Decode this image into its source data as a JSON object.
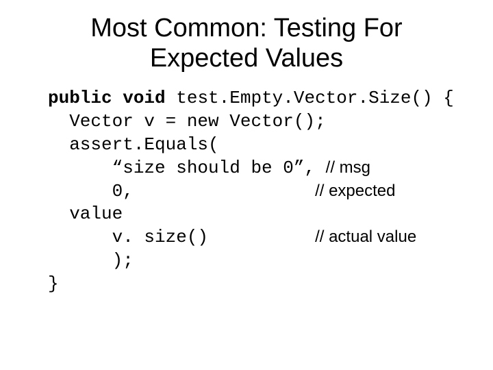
{
  "title_line1": "Most Common: Testing For",
  "title_line2": "Expected Values",
  "code": {
    "l1a": "public void",
    "l1b": " test.Empty.Vector.Size() {",
    "l2": "  Vector v = new Vector();",
    "l3": "  assert.Equals(",
    "l4a": "      “size should be 0”, ",
    "l4b": "// msg",
    "l5a": "      0,                 ",
    "l5b": "// expected",
    "l6": "  value",
    "l7a": "      v. size()          ",
    "l7b": "// actual value",
    "l8": "      );",
    "l9": "}"
  }
}
